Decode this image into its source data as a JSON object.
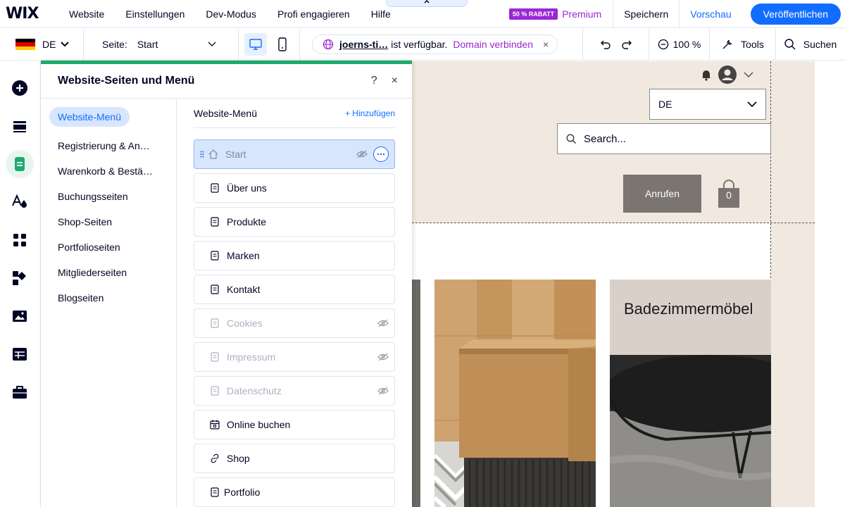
{
  "topbar": {
    "logo": "WIX",
    "menu": [
      "Website",
      "Einstellungen",
      "Dev-Modus",
      "Profi engagieren",
      "Hilfe"
    ],
    "badge": "50 % RABATT",
    "premium": "Premium",
    "save": "Speichern",
    "preview": "Vorschau",
    "publish": "Veröffentlichen"
  },
  "secondbar": {
    "language": "DE",
    "page_label": "Seite:",
    "page_value": "Start",
    "domain_name": "joerns-ti…",
    "domain_available": "ist verfügbar.",
    "domain_connect": "Domain verbinden",
    "domain_close": "×",
    "zoom": "100 %",
    "tools": "Tools",
    "search": "Suchen"
  },
  "left_toolbar": {
    "icons": [
      "add-icon",
      "sections-icon",
      "pages-icon",
      "design-icon",
      "apps-icon",
      "business-icon",
      "media-icon",
      "cms-icon",
      "portfolio-icon"
    ],
    "active_index": 2
  },
  "panel": {
    "title": "Website-Seiten und Menü",
    "help": "?",
    "close": "×",
    "nav": [
      {
        "label": "Website-Menü",
        "active": true
      },
      {
        "label": "Registrierung & An…"
      },
      {
        "label": "Warenkorb & Bestät…"
      },
      {
        "label": "Buchungsseiten"
      },
      {
        "label": "Shop-Seiten"
      },
      {
        "label": "Portfolioseiten"
      },
      {
        "label": "Mitgliederseiten"
      },
      {
        "label": "Blogseiten"
      }
    ],
    "main_title": "Website-Menü",
    "add_label": "+ Hinzufügen",
    "pages": [
      {
        "label": "Start",
        "icon": "home-icon",
        "selected": true,
        "hidden": true
      },
      {
        "label": "Über uns",
        "icon": "page-icon"
      },
      {
        "label": "Produkte",
        "icon": "page-icon"
      },
      {
        "label": "Marken",
        "icon": "page-icon"
      },
      {
        "label": "Kontakt",
        "icon": "page-icon"
      },
      {
        "label": "Cookies",
        "icon": "page-icon",
        "hidden": true
      },
      {
        "label": "Impressum",
        "icon": "page-icon",
        "hidden": true
      },
      {
        "label": "Datenschutz",
        "icon": "page-icon",
        "hidden": true
      },
      {
        "label": "Online buchen",
        "icon": "calendar-icon"
      },
      {
        "label": "Shop",
        "icon": "link-icon"
      },
      {
        "label": "Portfolio",
        "icon": "page-icon"
      }
    ]
  },
  "canvas": {
    "language_select": "DE",
    "search_placeholder": "Search...",
    "call_button": "Anrufen",
    "cart_count": "0",
    "card_title": "Badezimmermöbel"
  },
  "colors": {
    "accent_blue": "#116dff",
    "premium_purple": "#9a27d5",
    "panel_accent_green": "#1eaa6e",
    "site_beige": "#f1e9df"
  }
}
